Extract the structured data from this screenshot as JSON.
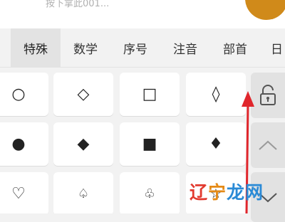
{
  "input": {
    "hint_text": "按下拿此001..."
  },
  "tabs": [
    {
      "label": "特殊",
      "active": true
    },
    {
      "label": "数学",
      "active": false
    },
    {
      "label": "序号",
      "active": false
    },
    {
      "label": "注音",
      "active": false
    },
    {
      "label": "部首",
      "active": false
    },
    {
      "label": "日",
      "active": false
    }
  ],
  "symbols": {
    "row1": [
      "○",
      "◇",
      "□",
      "◊"
    ],
    "row2": [
      "●",
      "◆",
      "■",
      "♦"
    ],
    "row3": [
      "♡",
      "♤",
      "♧",
      "☆"
    ]
  },
  "side_keys": {
    "lock": "unlock-icon",
    "up": "chevron-up-icon",
    "down": "chevron-down-icon"
  },
  "watermark": {
    "text": "辽宁龙网",
    "colors": [
      "#e23a2f",
      "#e58a16",
      "#2a8ad6",
      "#2a8ad6"
    ]
  },
  "colors": {
    "annotation_arrow": "#e0262c",
    "active_tab_bg": "#e3e3e3",
    "key_bg": "#ffffff",
    "side_key_bg": "#e2e2e2"
  }
}
